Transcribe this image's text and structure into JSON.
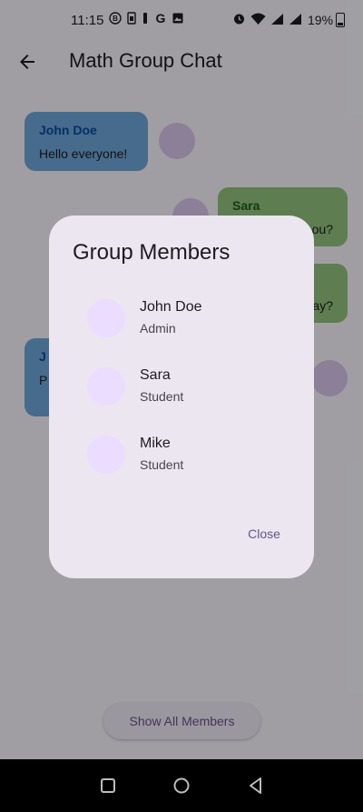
{
  "status_bar": {
    "time": "11:15",
    "battery_percent": "19%",
    "left_icons": [
      "b-notification-icon",
      "sim-icon",
      "battery-saver-icon",
      "google-icon",
      "image-icon"
    ],
    "right_icons": [
      "alarm-icon",
      "wifi-icon",
      "signal-icon",
      "signal-icon"
    ]
  },
  "app_bar": {
    "title": "Math Group Chat"
  },
  "chat": {
    "messages": [
      {
        "sender": "John Doe",
        "text": "Hello everyone!",
        "side": "left"
      },
      {
        "sender": "Sara",
        "text": "ou?",
        "side": "right"
      },
      {
        "sender": "",
        "text": "ay?",
        "side": "right"
      },
      {
        "sender": "J",
        "text": "P h",
        "side": "left"
      }
    ],
    "show_all_label": "Show All Members"
  },
  "dialog": {
    "title": "Group Members",
    "members": [
      {
        "name": "John Doe",
        "role": "Admin"
      },
      {
        "name": "Sara",
        "role": "Student"
      },
      {
        "name": "Mike",
        "role": "Student"
      }
    ],
    "close_label": "Close"
  },
  "colors": {
    "accent": "#65558f",
    "dialog_bg": "#ece6f0",
    "blue_bubble": "#6fa8dc",
    "green_bubble": "#93c47d"
  }
}
